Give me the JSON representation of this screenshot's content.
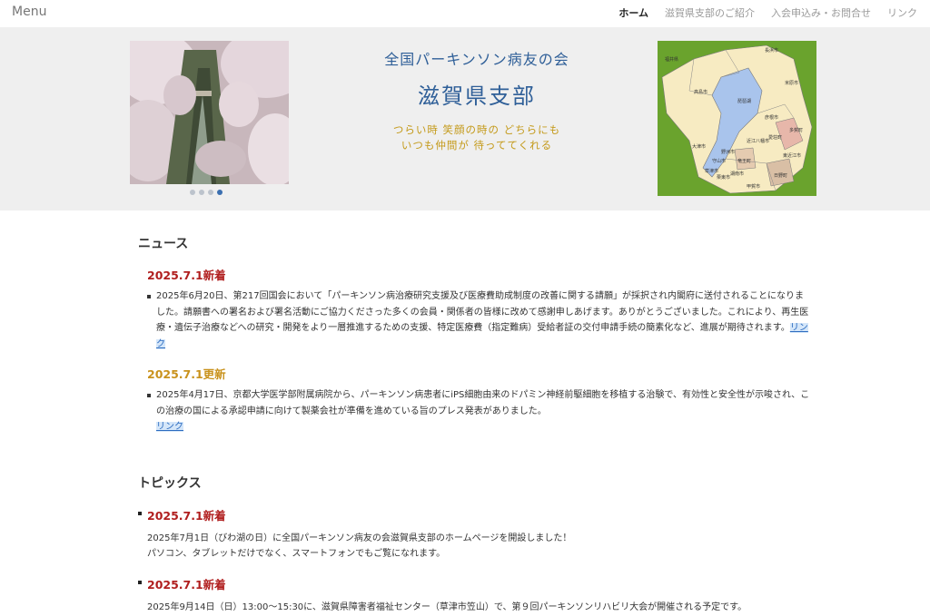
{
  "nav": {
    "menu_label": "Menu",
    "links": [
      "ホーム",
      "滋賀県支部のご紹介",
      "入会申込み・お問合せ",
      "リンク"
    ]
  },
  "hero": {
    "org_name": "全国パーキンソン病友の会",
    "branch": "滋賀県支部",
    "slogan_line1": "つらい時 笑顔の時の どちらにも",
    "slogan_line2": "いつも仲間が 待っててくれる",
    "carousel_total": 4,
    "carousel_active": 4
  },
  "news": {
    "title": "ニュース",
    "items": [
      {
        "date": "2025.7.1新着",
        "text": "2025年6月20日、第217回国会において「パーキンソン病治療研究支援及び医療費助成制度の改善に関する請願」が採択され内閣府に送付されることになりました。請願書への署名および署名活動にご協力くださった多くの会員・関係者の皆様に改めて感謝申しあげます。ありがとうございました。これにより、再生医療・遺伝子治療などへの研究・開発をより一層推進するための支援、特定医療費（指定難病）受給者証の交付申請手続の簡素化など、進展が期待されます。",
        "link": "リンク"
      },
      {
        "date": "2025.7.1更新",
        "text": "2025年4月17日、京都大学医学部附属病院から、パーキンソン病患者にiPS細胞由来のドパミン神経前駆細胞を移植する治験で、有効性と安全性が示唆され、この治療の国による承認申請に向けて製薬会社が準備を進めている旨のプレス発表がありました。",
        "link": "リンク"
      }
    ]
  },
  "topics": {
    "title": "トピックス",
    "items": [
      {
        "date": "2025.7.1新着",
        "line1": "2025年7月1日（びわ湖の日）に全国パーキンソン病友の会滋賀県支部のホームページを開設しました！",
        "line2": "パソコン、タブレットだけでなく、スマートフォンでもご覧になれます。"
      },
      {
        "date": "2025.7.1新着",
        "line1": "2025年9月14日（日）13:00〜15:30に、滋賀県障害者福祉センター（草津市笠山）で、第９回パーキンソンリハビリ大会が開催される予定です。",
        "line2": ""
      }
    ]
  },
  "map_labels": [
    "福井県",
    "長浜市",
    "米原市",
    "高島市",
    "琵琶湖",
    "彦根市",
    "大津市",
    "近江八幡市",
    "東近江市",
    "甲賀市",
    "日野町",
    "野洲市",
    "守山市",
    "草津市",
    "栗東市",
    "湖南市",
    "竜王町",
    "多賀町",
    "愛荘町"
  ],
  "colors": {
    "accent_blue": "#2f5f98",
    "news_red": "#b01e1e",
    "news_gold": "#c9921c",
    "slogan_gold": "#c49a1a",
    "hero_bg": "#efefef",
    "link_blue": "#2d6cc0"
  }
}
